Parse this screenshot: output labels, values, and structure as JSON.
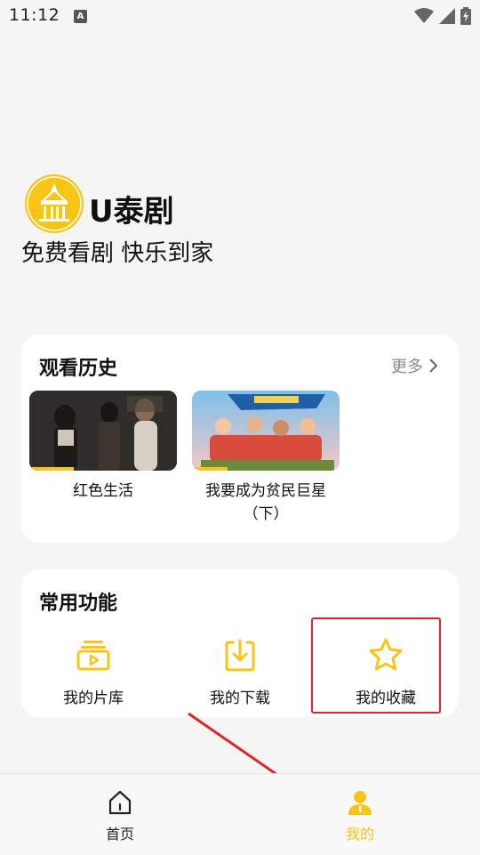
{
  "status_bar": {
    "time": "11:12",
    "notification_icon": "A",
    "icons": [
      "wifi-icon",
      "signal-icon",
      "battery-charging-icon"
    ]
  },
  "brand": {
    "app_name": "U泰剧",
    "slogan": "免费看剧 快乐到家",
    "logo_icon": "thai-temple-logo",
    "accent_color": "#f8c416"
  },
  "history": {
    "title": "观看历史",
    "more_label": "更多",
    "items": [
      {
        "title": "红色生活"
      },
      {
        "title": "我要成为贫民巨星\n（下）"
      }
    ]
  },
  "functions": {
    "title": "常用功能",
    "items": [
      {
        "label": "我的片库",
        "icon": "video-library-icon"
      },
      {
        "label": "我的下载",
        "icon": "download-icon"
      },
      {
        "label": "我的收藏",
        "icon": "star-icon"
      }
    ]
  },
  "tabbar": {
    "items": [
      {
        "label": "首页",
        "icon": "home-icon",
        "active": false
      },
      {
        "label": "我的",
        "icon": "user-icon",
        "active": true
      }
    ],
    "active_color": "#f8c416"
  },
  "annotation": {
    "highlight_color": "#e0252a"
  }
}
